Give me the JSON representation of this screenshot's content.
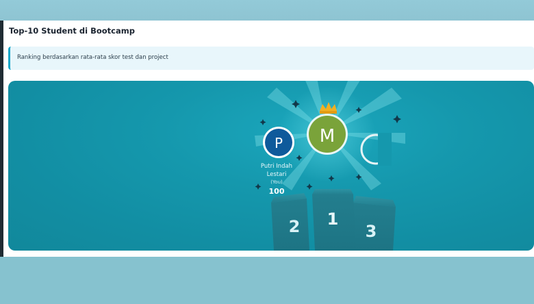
{
  "page": {
    "title": "Top-10 Student di Bootcamp",
    "info": "Ranking berdasarkan rata-rata skor test dan project"
  },
  "leaderboard": {
    "first": {
      "initial": "M",
      "rank": "1"
    },
    "second": {
      "initial": "P",
      "name_line1": "Putri Indah",
      "name_line2": "Lestari",
      "tag": "(You)",
      "score": "100",
      "rank": "2"
    },
    "third": {
      "rank": "3"
    }
  },
  "colors": {
    "hero_bg": "#1598ad",
    "gold_avatar": "#7aa33a",
    "blue_avatar": "#0f5a9b",
    "crown": "#f2b021"
  },
  "icons": [
    "crown-icon",
    "sparkle-icon"
  ]
}
